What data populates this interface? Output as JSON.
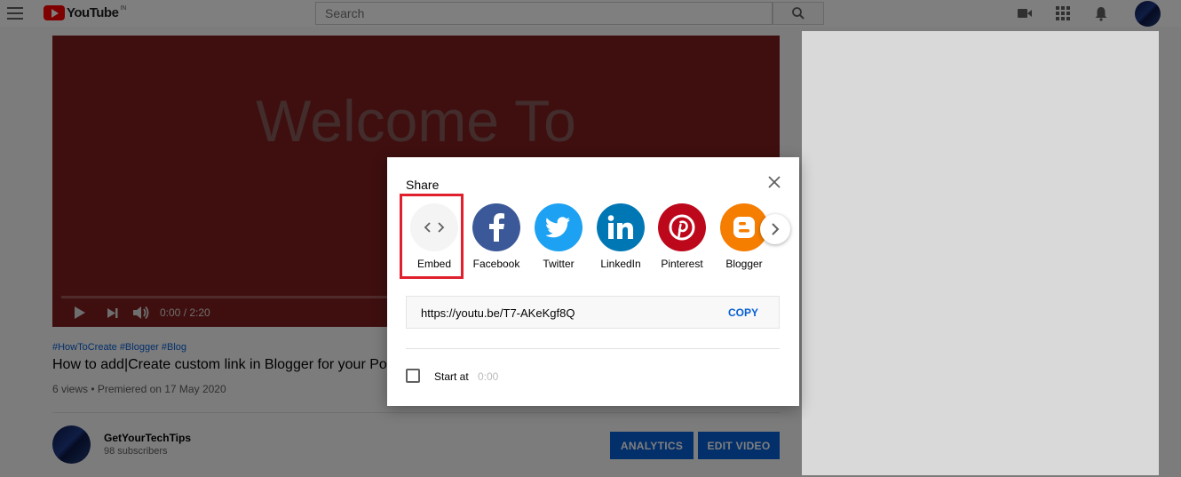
{
  "masthead": {
    "logo_text": "YouTube",
    "region": "IN",
    "search_placeholder": "Search"
  },
  "video": {
    "player_text": "Welcome To",
    "time": "0:00 / 2:20",
    "hashtags": "#HowToCreate #Blogger #Blog",
    "title": "How to add|Create custom link in Blogger for your Po",
    "meta": "6 views • Premiered on 17 May 2020"
  },
  "channel": {
    "name": "GetYourTechTips",
    "subscribers": "98 subscribers"
  },
  "actions": {
    "analytics": "ANALYTICS",
    "edit_video": "EDIT VIDEO"
  },
  "share": {
    "title": "Share",
    "targets": [
      {
        "label": "Embed",
        "icon": "embed-code-icon",
        "color": "#f4f4f4"
      },
      {
        "label": "Facebook",
        "icon": "facebook-icon",
        "color": "#3b5998"
      },
      {
        "label": "Twitter",
        "icon": "twitter-icon",
        "color": "#1da1f2"
      },
      {
        "label": "LinkedIn",
        "icon": "linkedin-icon",
        "color": "#0077b5"
      },
      {
        "label": "Pinterest",
        "icon": "pinterest-icon",
        "color": "#bd081c"
      },
      {
        "label": "Blogger",
        "icon": "blogger-icon",
        "color": "#f57d00"
      }
    ],
    "link": "https://youtu.be/T7-AKeKgf8Q",
    "copy": "COPY",
    "start_at_label": "Start at",
    "start_at_value": "0:00"
  },
  "colors": {
    "accent_blue": "#065fd4",
    "highlight_red": "#e0202d",
    "youtube_red": "#ff0000"
  }
}
